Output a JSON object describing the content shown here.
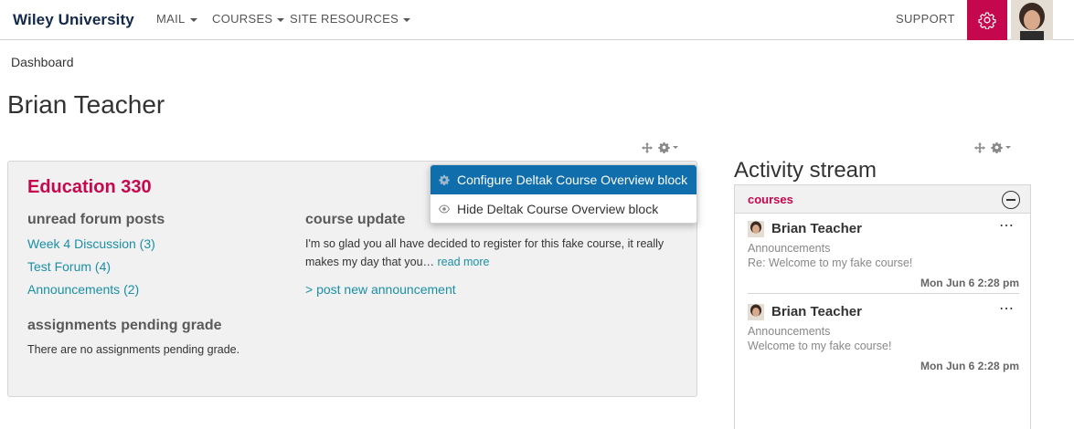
{
  "nav": {
    "brand": "Wiley University",
    "menus": [
      {
        "label": "MAIL"
      },
      {
        "label": "COURSES"
      },
      {
        "label": "SITE RESOURCES"
      }
    ],
    "support": "SUPPORT",
    "accent_color": "#c5084e"
  },
  "breadcrumb": "Dashboard",
  "page_title": "Brian Teacher",
  "course_block": {
    "title": "Education 330",
    "unread_heading": "unread forum posts",
    "forums": [
      {
        "label": "Week 4 Discussion (3)"
      },
      {
        "label": "Test Forum (4)"
      },
      {
        "label": "Announcements (2)"
      }
    ],
    "pending_heading": "assignments pending grade",
    "pending_text": "There are no assignments pending grade.",
    "update_heading": "course update",
    "update_line1": "I'm so glad you all have decided to register for this fake course, it really",
    "update_line2": "makes my day that you…",
    "read_more": "read more",
    "post_announcement": "> post new announcement"
  },
  "dropdown": {
    "configure_label": "Configure Deltak Course Overview block",
    "hide_label": "Hide Deltak Course Overview block"
  },
  "activity_stream": {
    "title": "Activity stream",
    "filter": "courses",
    "items": [
      {
        "name": "Brian Teacher",
        "category": "Announcements",
        "message": "Re: Welcome to my fake course!",
        "time": "Mon Jun 6 2:28 pm"
      },
      {
        "name": "Brian Teacher",
        "category": "Announcements",
        "message": "Welcome to my fake course!",
        "time": "Mon Jun 6 2:28 pm"
      }
    ]
  },
  "icons": [
    "gear-icon",
    "move-icon",
    "eye-icon",
    "collapse-icon",
    "more-options-icon"
  ]
}
